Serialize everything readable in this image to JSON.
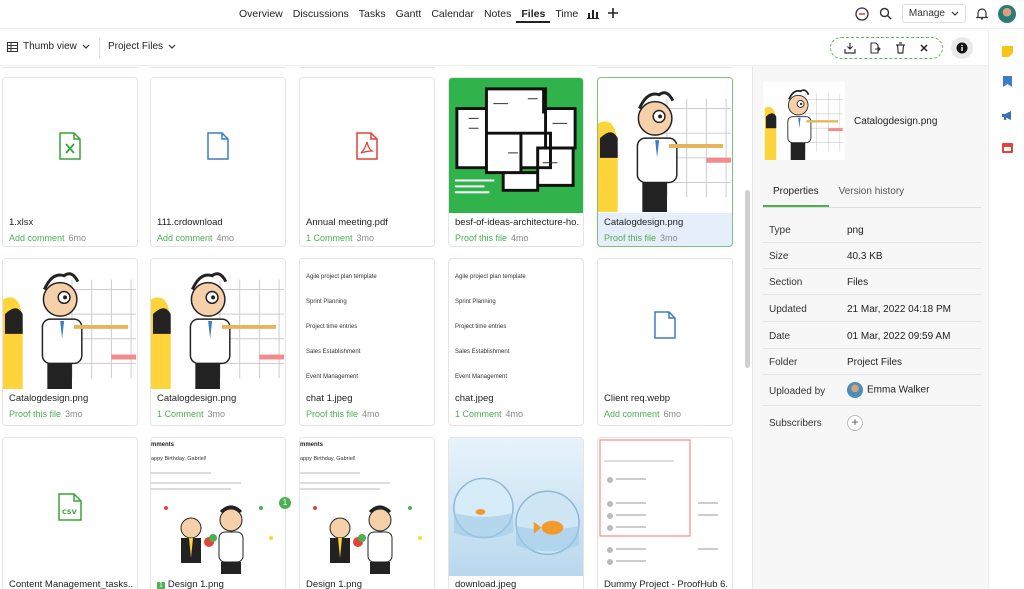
{
  "nav": {
    "tabs": [
      "Overview",
      "Discussions",
      "Tasks",
      "Gantt",
      "Calendar",
      "Notes",
      "Files",
      "Time"
    ],
    "active_tab": "Files",
    "manage_label": "Manage"
  },
  "toolbar": {
    "view_label": "Thumb view",
    "folder_label": "Project Files"
  },
  "files": [
    {
      "name": "1.xlsx",
      "action": "Add comment",
      "age": "6mo",
      "icon": "excel-icon",
      "color": "#3aa335"
    },
    {
      "name": "111.crdownload",
      "action": "Add comment",
      "age": "4mo",
      "icon": "file-icon",
      "color": "#3b7dc4"
    },
    {
      "name": "Annual meeting.pdf",
      "action": "1 Comment",
      "age": "3mo",
      "icon": "pdf-icon",
      "color": "#e0443a"
    },
    {
      "name": "besf-of-ideas-architecture-ho...",
      "action": "Proof this file",
      "age": "4mo",
      "icon": "floorplan-image"
    },
    {
      "name": "Catalogdesign.png",
      "action": "Proof this file",
      "age": "3mo",
      "icon": "cartoon-image",
      "selected": true
    },
    {
      "name": "Catalogdesign.png",
      "action": "Proof this file",
      "age": "3mo",
      "icon": "cartoon-image"
    },
    {
      "name": "Catalogdesign.png",
      "action": "1 Comment",
      "age": "3mo",
      "icon": "cartoon-image"
    },
    {
      "name": "chat 1.jpeg",
      "action": "Proof this file",
      "age": "4mo",
      "icon": "chat-image"
    },
    {
      "name": "chat.jpeg",
      "action": "1 Comment",
      "age": "4mo",
      "icon": "chat-image"
    },
    {
      "name": "Client req.webp",
      "action": "Add comment",
      "age": "6mo",
      "icon": "file-icon",
      "color": "#3b7dc4"
    },
    {
      "name": "Content Management_tasks...",
      "action": "",
      "age": "",
      "icon": "csv-icon",
      "color": "#3aa335"
    },
    {
      "name": "Design 1.png",
      "action": "",
      "age": "",
      "icon": "birthday-image",
      "prefix": "1"
    },
    {
      "name": "Design 1.png",
      "action": "",
      "age": "",
      "icon": "birthday-image"
    },
    {
      "name": "download.jpeg",
      "action": "",
      "age": "",
      "icon": "fishbowl-image"
    },
    {
      "name": "Dummy Project - ProofHub 6...",
      "action": "",
      "age": "",
      "icon": "screenshot-image"
    }
  ],
  "chat_items": [
    "Agile project plan template",
    "Sprint Planning",
    "Project time entries",
    "Sales Establishment",
    "Event Management"
  ],
  "birthday": {
    "heading": "mments",
    "greeting": "appy Birthday, Gabriel!"
  },
  "badge_count": "1",
  "panel": {
    "file_name": "Catalogdesign.png",
    "tabs": [
      "Properties",
      "Version history"
    ],
    "properties": [
      {
        "key": "Type",
        "value": "png"
      },
      {
        "key": "Size",
        "value": "40.3 KB"
      },
      {
        "key": "Section",
        "value": "Files"
      },
      {
        "key": "Updated",
        "value": "21 Mar, 2022 04:18 PM"
      },
      {
        "key": "Date",
        "value": "01 Mar, 2022 09:59 AM"
      },
      {
        "key": "Folder",
        "value": "Project Files"
      },
      {
        "key": "Uploaded by",
        "value": "Emma Walker"
      },
      {
        "key": "Subscribers",
        "value": ""
      }
    ]
  },
  "colors": {
    "accent": "#4caf50",
    "selected_bg": "#e6eefc"
  }
}
